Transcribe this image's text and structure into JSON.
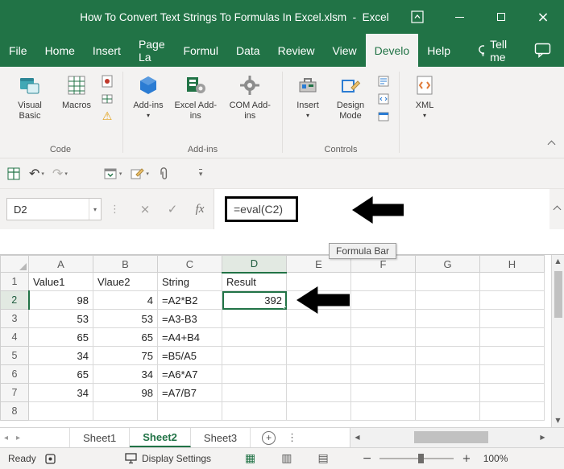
{
  "colors": {
    "excel_green": "#217346",
    "selection_green": "#217346",
    "warning_yellow": "#e3a21a",
    "annotation_black": "#000000"
  },
  "title_bar": {
    "title": "How To Convert Text Strings To Formulas In Excel.xlsm  -  Excel"
  },
  "ribbon_tabs": {
    "items": [
      "File",
      "Home",
      "Insert",
      "Page La",
      "Formul",
      "Data",
      "Review",
      "View",
      "Develo",
      "Help"
    ],
    "active": "Develo",
    "tell_me": "Tell me"
  },
  "ribbon": {
    "code_group": {
      "label": "Code",
      "visual_basic": "Visual Basic",
      "macros": "Macros"
    },
    "addins_group": {
      "label": "Add-ins",
      "add_ins": "Add-ins",
      "excel_add_ins": "Excel Add-ins",
      "com_add_ins": "COM Add-ins"
    },
    "controls_group": {
      "label": "Controls",
      "insert": "Insert",
      "design_mode": "Design Mode"
    },
    "xml_group": {
      "xml": "XML"
    }
  },
  "formula_bar": {
    "name_box": "D2",
    "fx": "fx",
    "formula": "=eval(C2)",
    "tooltip": "Formula Bar"
  },
  "grid": {
    "columns": [
      "A",
      "B",
      "C",
      "D",
      "E",
      "F",
      "G",
      "H"
    ],
    "rows": [
      {
        "n": "1",
        "a": "Value1",
        "b": "Vlaue2",
        "c": "String",
        "d": "Result"
      },
      {
        "n": "2",
        "a": "98",
        "b": "4",
        "c": "=A2*B2",
        "d": "392"
      },
      {
        "n": "3",
        "a": "53",
        "b": "53",
        "c": "=A3-B3",
        "d": ""
      },
      {
        "n": "4",
        "a": "65",
        "b": "65",
        "c": "=A4+B4",
        "d": ""
      },
      {
        "n": "5",
        "a": "34",
        "b": "75",
        "c": "=B5/A5",
        "d": ""
      },
      {
        "n": "6",
        "a": "65",
        "b": "34",
        "c": "=A6*A7",
        "d": ""
      },
      {
        "n": "7",
        "a": "34",
        "b": "98",
        "c": "=A7/B7",
        "d": ""
      },
      {
        "n": "8",
        "a": "",
        "b": "",
        "c": "",
        "d": ""
      }
    ],
    "selected_cell": "D2",
    "selected_value": "392"
  },
  "sheet_tabs": {
    "tabs": [
      "Sheet1",
      "Sheet2",
      "Sheet3"
    ],
    "active": "Sheet2"
  },
  "status_bar": {
    "ready": "Ready",
    "display_settings": "Display Settings",
    "zoom": "100%"
  },
  "glyphs": {
    "dropdown": "▾",
    "undo": "↶",
    "redo": "↷",
    "close_x": "×",
    "check": "✓",
    "dots_v": "⋮",
    "up": "▲",
    "down": "▼",
    "left": "◀",
    "right": "▶",
    "left_small": "◂",
    "right_small": "▸",
    "warning": "⚠",
    "plus": "+",
    "minus": "−",
    "grid_view": "▦",
    "page_view": "▥",
    "break_view": "▤"
  }
}
